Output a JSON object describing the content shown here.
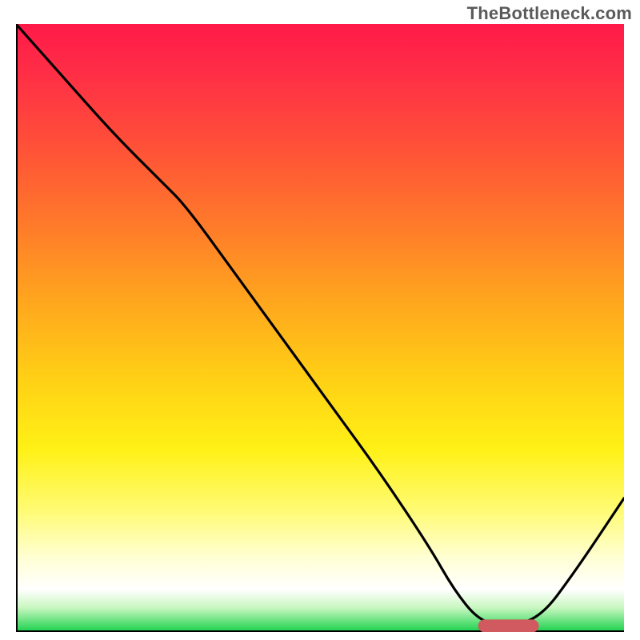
{
  "watermark": "TheBottleneck.com",
  "chart_data": {
    "type": "line",
    "title": "",
    "xlabel": "",
    "ylabel": "",
    "xlim": [
      0,
      100
    ],
    "ylim": [
      0,
      100
    ],
    "grid": false,
    "legend": false,
    "series": [
      {
        "name": "curve",
        "color": "#000000",
        "x": [
          0,
          8,
          16,
          24,
          28,
          36,
          44,
          52,
          60,
          68,
          72,
          76,
          80,
          86,
          92,
          100
        ],
        "y": [
          100,
          91,
          82,
          74,
          70,
          59,
          48,
          37,
          26,
          14,
          7,
          2,
          1,
          2,
          10,
          22
        ]
      }
    ],
    "marker": {
      "name": "optimum-range",
      "shape": "capsule",
      "color": "#d05a5f",
      "x_start": 76,
      "x_end": 86,
      "y": 1
    },
    "gradient_stops": [
      {
        "pos": 0.0,
        "color": "#ff1a49"
      },
      {
        "pos": 0.2,
        "color": "#ff5038"
      },
      {
        "pos": 0.45,
        "color": "#ffa41e"
      },
      {
        "pos": 0.7,
        "color": "#fff116"
      },
      {
        "pos": 0.93,
        "color": "#ffffff"
      },
      {
        "pos": 1.0,
        "color": "#18d14a"
      }
    ]
  }
}
